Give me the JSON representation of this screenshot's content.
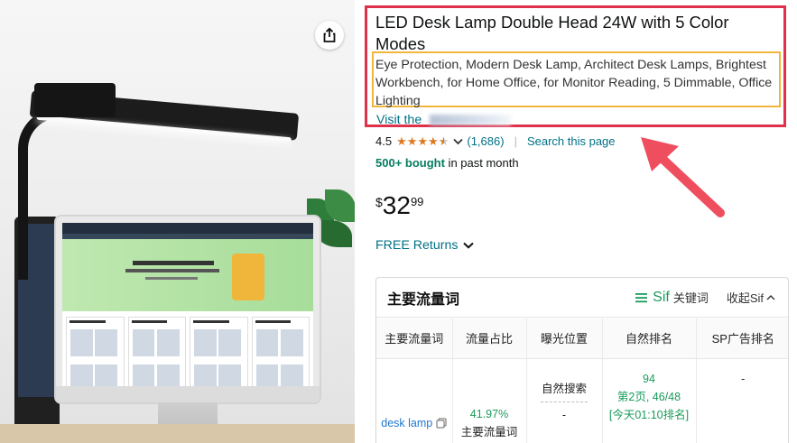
{
  "product": {
    "title": "LED Desk Lamp Double Head 24W with 5 Color Modes",
    "subtitle": "Eye Protection, Modern Desk Lamp, Architect Desk Lamps, Brightest Workbench, for Home Office, for Monitor Reading, 5 Dimmable, Office Lighting",
    "store_link": "Visit the",
    "rating": "4.5",
    "stars": 4.5,
    "review_count": "(1,686)",
    "separator": "|",
    "search_page": "Search this page",
    "bought_bold": "500+ bought",
    "bought_rest": " in past month",
    "price_symbol": "$",
    "price_whole": "32",
    "price_fraction": "99",
    "free_returns": "FREE Returns"
  },
  "extension": {
    "title": "主要流量词",
    "sif_brand": "Sif",
    "sif_link": "关键词",
    "collapse_label": "收起Sif",
    "columns": [
      "主要流量词",
      "流量占比",
      "曝光位置",
      "自然排名",
      "SP广告排名"
    ],
    "row": {
      "keyword": "desk lamp",
      "share": "41.97%",
      "share_label": "主要流量词",
      "position_label": "自然搜索",
      "position_dash": "-",
      "rank": "94",
      "rank_page": "第2页, 46/48",
      "rank_time": "[今天01:10排名]",
      "sp_rank": "-"
    }
  },
  "colors": {
    "highlight_red": "#e0314b",
    "highlight_yellow": "#f2b63a",
    "link": "#007185",
    "star": "#de7921",
    "sif_green": "#1a9b5a"
  }
}
